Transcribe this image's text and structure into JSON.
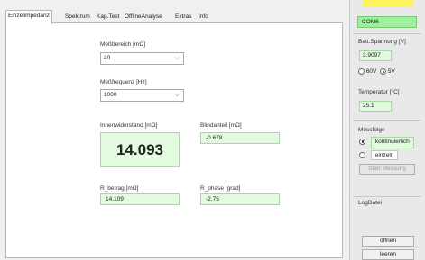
{
  "tabs": [
    "Einzelimpedanz",
    "Spektrum",
    "Kap.Test",
    "OfflineAnalyse",
    "Extras",
    "Info"
  ],
  "main": {
    "messbereich": {
      "label": "Meßbereich [mΩ]",
      "value": "30"
    },
    "messfrequenz": {
      "label": "Meßfrequenz [Hz]",
      "value": "1000"
    },
    "innenwiderstand": {
      "label": "Innenwiderstand [mΩ]",
      "value": "14.093"
    },
    "blindanteil": {
      "label": "Blindanteil [mΩ]",
      "value": "-0.678"
    },
    "r_betrag": {
      "label": "R_betrag [mΩ]",
      "value": "14.109"
    },
    "r_phase": {
      "label": "R_phase [grad]",
      "value": "-2.75"
    }
  },
  "side": {
    "com_port": "COM6",
    "batt_spannung": {
      "label": "Batt.Spannung [V]",
      "value": "3.9097"
    },
    "voltage_options": [
      {
        "label": "60V",
        "selected": false
      },
      {
        "label": "5V",
        "selected": true
      }
    ],
    "temperatur": {
      "label": "Temperatur [°C]",
      "value": "25.1"
    },
    "messfolge": {
      "label": "Messfolge",
      "options": [
        {
          "label": "kontinuierlich",
          "selected": true
        },
        {
          "label": "einzeln",
          "selected": false
        }
      ]
    },
    "start_button": "Start Messung",
    "logdatei": {
      "label": "LogDatei",
      "open_button": "öffnen",
      "clear_button": "leeren"
    }
  },
  "colors": {
    "value_bg": "#e2fbdf",
    "com_bg": "#9ff09b",
    "accent_yellow": "#fff35c"
  }
}
